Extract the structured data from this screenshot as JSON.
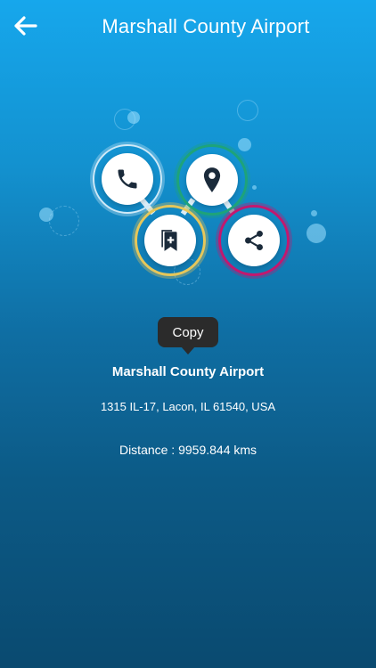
{
  "header": {
    "back_icon": "arrow-left-icon",
    "title": "Marshall County Airport"
  },
  "actions": [
    {
      "name": "call",
      "icon": "phone-icon",
      "ring_color": "#cfe9f7"
    },
    {
      "name": "location",
      "icon": "map-pin-icon",
      "ring_color": "#1ea37a"
    },
    {
      "name": "bookmark",
      "icon": "bookmark-add-icon",
      "ring_color": "#e6c75a"
    },
    {
      "name": "share",
      "icon": "share-icon",
      "ring_color": "#c2186f"
    }
  ],
  "tooltip": {
    "label": "Copy"
  },
  "details": {
    "name": "Marshall County Airport",
    "address": "1315 IL-17, Lacon, IL 61540, USA",
    "distance": "Distance : 9959.844 kms"
  }
}
